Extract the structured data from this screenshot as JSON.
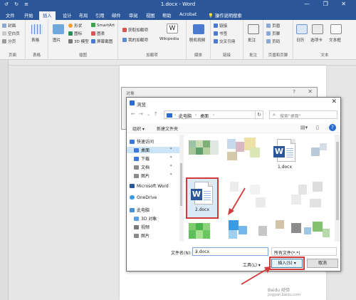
{
  "window": {
    "title": "1.docx - Word",
    "quick_access": "↺ ↻ ≡",
    "controls": "— ❐ ✕"
  },
  "tabs": [
    {
      "label": "文件"
    },
    {
      "label": "开始"
    },
    {
      "label": "插入",
      "active": true
    },
    {
      "label": "设计"
    },
    {
      "label": "布局"
    },
    {
      "label": "引用"
    },
    {
      "label": "邮件"
    },
    {
      "label": "审阅"
    },
    {
      "label": "视图"
    },
    {
      "label": "帮助"
    },
    {
      "label": "Acrobat"
    }
  ],
  "tell_me": "操作说明搜索",
  "ribbon": {
    "pages": {
      "items": [
        "封面",
        "空白页",
        "分页"
      ],
      "label": "页面"
    },
    "tables": {
      "item": "表格",
      "label": "表格"
    },
    "illustrations": {
      "items": [
        "图片",
        "形状",
        "图标",
        "3D 模型",
        "SmartArt",
        "图表",
        "屏幕截图"
      ],
      "label": "插图"
    },
    "addins": {
      "items": [
        "获取加载项",
        "我的加载项"
      ],
      "wikipedia": "Wikipedia",
      "label": "加载项"
    },
    "media": {
      "item": "联机视频",
      "label": "媒体"
    },
    "links": {
      "items": [
        "链接",
        "书签",
        "交叉引用"
      ],
      "label": "链接"
    },
    "comments": {
      "item": "批注",
      "label": "批注"
    },
    "header_footer": {
      "items": [
        "页眉",
        "页脚",
        "页码"
      ],
      "label": "页眉和页脚"
    },
    "text": {
      "items": [
        "日历",
        "选项卡",
        "文本框"
      ],
      "label": "文本"
    }
  },
  "object_dialog": {
    "title": "对象",
    "help": "?",
    "close": "✕"
  },
  "browse_dialog": {
    "title": "浏览",
    "close": "✕",
    "nav": {
      "back": "←",
      "forward": "→",
      "up": "↑",
      "dropdown": "⌄"
    },
    "breadcrumb": [
      "此电脑",
      "桌面"
    ],
    "refresh": "↻",
    "search_placeholder": "搜索\"桌面\"",
    "toolbar": {
      "organize": "组织 ▾",
      "new_folder": "新建文件夹",
      "help": "?"
    },
    "nav_pane": [
      {
        "label": "快速访问",
        "color": "#3b78d8"
      },
      {
        "label": "桌面",
        "color": "#3b78d8",
        "selected": true
      },
      {
        "label": "下载",
        "color": "#3b78d8"
      },
      {
        "label": "文档",
        "color": "#8a8a8a"
      },
      {
        "label": "图片",
        "color": "#8a8a8a"
      },
      {
        "label": "Microsoft Word",
        "color": "#2b579a"
      },
      {
        "label": "OneDrive",
        "color": "#3b9ae0"
      },
      {
        "label": "此电脑",
        "color": "#4a90d9"
      },
      {
        "label": "3D 对象",
        "color": "#5aa0e0"
      },
      {
        "label": "视频",
        "color": "#7a7a7a"
      },
      {
        "label": "图片",
        "color": "#8a8a8a"
      }
    ],
    "files": [
      {
        "name": "1.docx"
      },
      {
        "name": "2.docx",
        "selected": true
      }
    ],
    "filename_label": "文件名(N):",
    "filename_value": "2.docx",
    "filetype_value": "所有文件(*.*)",
    "tools_label": "工具(L) ▾",
    "insert_button": "插入(S)",
    "insert_dropdown": "▾",
    "cancel_button": "取消"
  },
  "watermark": {
    "line1": "Baidu 经验",
    "line2": "jingyan.baidu.com"
  },
  "colors": {
    "word_blue": "#2b579a",
    "highlight_red": "#d43a3a"
  }
}
